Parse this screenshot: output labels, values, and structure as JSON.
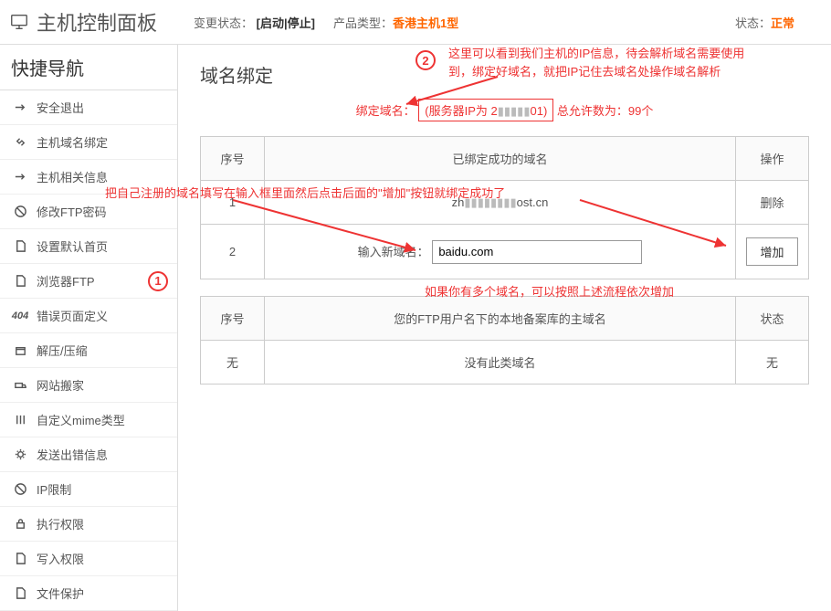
{
  "header": {
    "title": "主机控制面板",
    "change_status_label": "变更状态：",
    "change_status_value": "[启动|停止]",
    "product_type_label": "产品类型：",
    "product_type_value": "香港主机1型",
    "status_label": "状态：",
    "status_value": "正常"
  },
  "sidebar": {
    "title": "快捷导航",
    "items": [
      {
        "label": "安全退出"
      },
      {
        "label": "主机域名绑定"
      },
      {
        "label": "主机相关信息"
      },
      {
        "label": "修改FTP密码"
      },
      {
        "label": "设置默认首页"
      },
      {
        "label": "浏览器FTP"
      },
      {
        "label": "错误页面定义"
      },
      {
        "label": "解压/压缩"
      },
      {
        "label": "网站搬家"
      },
      {
        "label": "自定义mime类型"
      },
      {
        "label": "发送出错信息"
      },
      {
        "label": "IP限制"
      },
      {
        "label": "执行权限"
      },
      {
        "label": "写入权限"
      },
      {
        "label": "文件保护"
      }
    ]
  },
  "page": {
    "title": "域名绑定",
    "bind_label": "绑定域名：",
    "server_ip_label": "(服务器IP为 2",
    "server_ip_tail": "01)",
    "allow_count": " 总允许数为：99个",
    "input_label": "输入新域名：",
    "input_value": "baidu.com"
  },
  "table1": {
    "h_idx": "序号",
    "h_domain": "已绑定成功的域名",
    "h_op": "操作",
    "row1_idx": "1",
    "row1_domain_prefix": "zh",
    "row1_domain_suffix": "ost.cn",
    "row1_op": "删除",
    "row2_idx": "2",
    "row2_op": "增加"
  },
  "table2": {
    "h_idx": "序号",
    "h_domain": "您的FTP用户名下的本地备案库的主域名",
    "h_op": "状态",
    "row1_idx": "无",
    "row1_domain": "没有此类域名",
    "row1_op": "无"
  },
  "anno": {
    "n1": "1",
    "n2": "2",
    "text1": "把自己注册的域名填写在输入框里面然后点击后面的\"增加\"按钮就绑定成功了",
    "text2a": "这里可以看到我们主机的IP信息，待会解析域名需要使用",
    "text2b": "到，绑定好域名，就把IP记住去域名处操作域名解析",
    "text3": "如果你有多个域名，可以按照上述流程依次增加"
  }
}
